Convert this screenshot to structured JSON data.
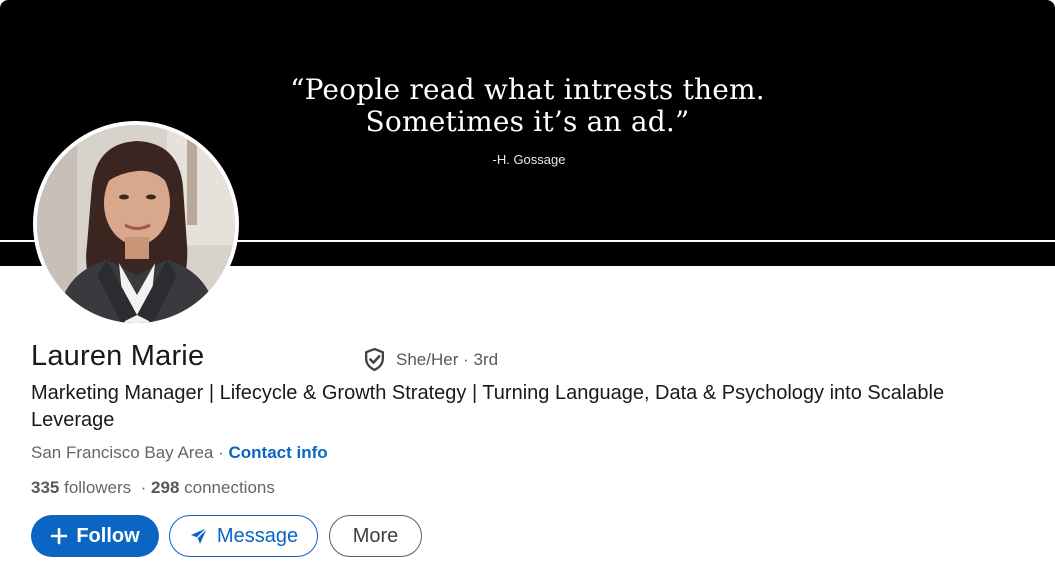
{
  "banner": {
    "quote_line_1": "“People read what intrests them.",
    "quote_line_2": "Sometimes it’s an ad.”",
    "author": "-H. Gossage"
  },
  "profile": {
    "name": "Lauren Marie",
    "pronouns": "She/Her",
    "degree": "· 3rd",
    "headline": "Marketing Manager | Lifecycle & Growth Strategy | Turning Language, Data & Psychology into Scalable Leverage",
    "location": "San Francisco Bay Area",
    "separator": " · ",
    "contact_info": "Contact info",
    "followers_count": "335",
    "followers_label": " followers",
    "connections_sep": "  · ",
    "connections_count": "298",
    "connections_label": " connections"
  },
  "actions": {
    "follow": "Follow",
    "message": "Message",
    "more": "More"
  },
  "icons": {
    "verified": "shield-check-icon",
    "follow": "plus-icon",
    "message": "paper-plane-icon"
  },
  "colors": {
    "primary": "#0a66c2",
    "banner": "#000000",
    "text": "#191919",
    "muted": "#666666"
  }
}
